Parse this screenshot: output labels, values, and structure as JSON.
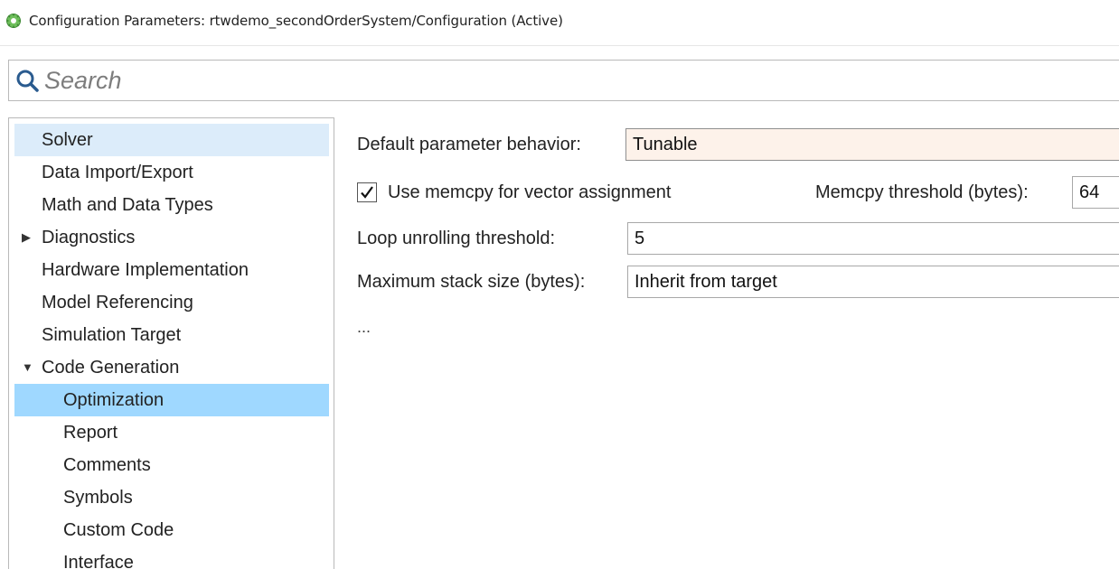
{
  "window": {
    "title": "Configuration Parameters: rtwdemo_secondOrderSystem/Configuration (Active)",
    "icon": "gear-app-icon"
  },
  "search": {
    "placeholder": "Search",
    "value": ""
  },
  "tree": {
    "items": [
      {
        "label": "Solver",
        "level": 0,
        "state": "selected"
      },
      {
        "label": "Data Import/Export",
        "level": 0
      },
      {
        "label": "Math and Data Types",
        "level": 0
      },
      {
        "label": "Diagnostics",
        "level": 0,
        "expander": "collapsed"
      },
      {
        "label": "Hardware Implementation",
        "level": 0
      },
      {
        "label": "Model Referencing",
        "level": 0
      },
      {
        "label": "Simulation Target",
        "level": 0
      },
      {
        "label": "Code Generation",
        "level": 0,
        "expander": "expanded"
      },
      {
        "label": "Optimization",
        "level": 1,
        "state": "active"
      },
      {
        "label": "Report",
        "level": 1
      },
      {
        "label": "Comments",
        "level": 1
      },
      {
        "label": "Symbols",
        "level": 1
      },
      {
        "label": "Custom Code",
        "level": 1
      },
      {
        "label": "Interface",
        "level": 1
      }
    ]
  },
  "optimization": {
    "default_param_label": "Default parameter behavior:",
    "default_param_value": "Tunable",
    "memcpy_checkbox_label": "Use memcpy for vector assignment",
    "memcpy_checked": true,
    "memcpy_threshold_label": "Memcpy threshold (bytes):",
    "memcpy_threshold_value": "64",
    "loop_unroll_label": "Loop unrolling threshold:",
    "loop_unroll_value": "5",
    "max_stack_label": "Maximum stack size (bytes):",
    "max_stack_value": "Inherit from target",
    "more_indicator": "..."
  },
  "colors": {
    "tree_selected": "#dcecfa",
    "tree_active": "#9fd8ff",
    "highlight_field": "#fdf2ea"
  }
}
